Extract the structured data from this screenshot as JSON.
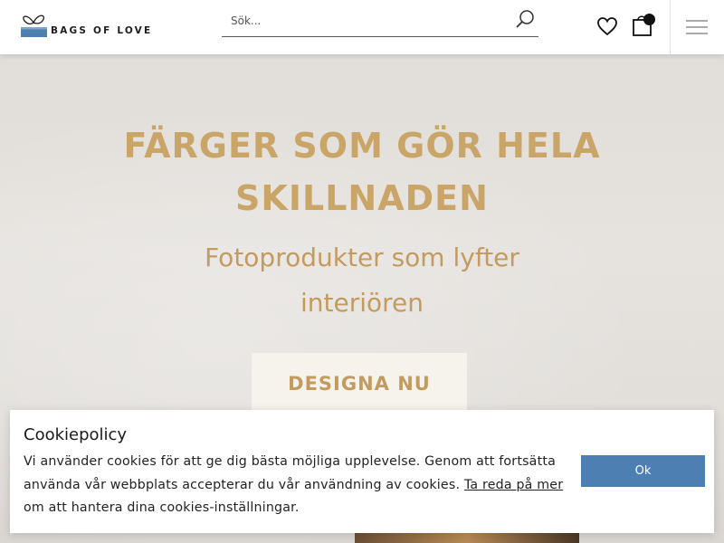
{
  "header": {
    "logo_text": "BAGS OF LOVE",
    "search": {
      "placeholder": "Sök..."
    },
    "icons": [
      "search-icon",
      "heart-icon",
      "shopping-bag-icon",
      "menu-icon"
    ]
  },
  "hero": {
    "title_line1": "FÄRGER SOM GÖR HELA",
    "title_line2": "SKILLNADEN",
    "subtitle_line1": "Fotoprodukter som lyfter",
    "subtitle_line2": "interiören",
    "cta_label": "DESIGNA NU"
  },
  "cookie": {
    "title": "Cookiepolicy",
    "text_before": "Vi använder cookies för att ge dig bästa möjliga upplevelse. Genom att fortsätta använda vår webbplats accepterar du vår användning av cookies. ",
    "link_label": "Ta reda på mer",
    "text_after": " om att hantera dina cookies-inställningar.",
    "ok_label": "Ok"
  },
  "colors": {
    "accent_gold": "#c39b5f",
    "button_blue": "#4e7fb2",
    "logo_blue": "#4f7fb0"
  }
}
